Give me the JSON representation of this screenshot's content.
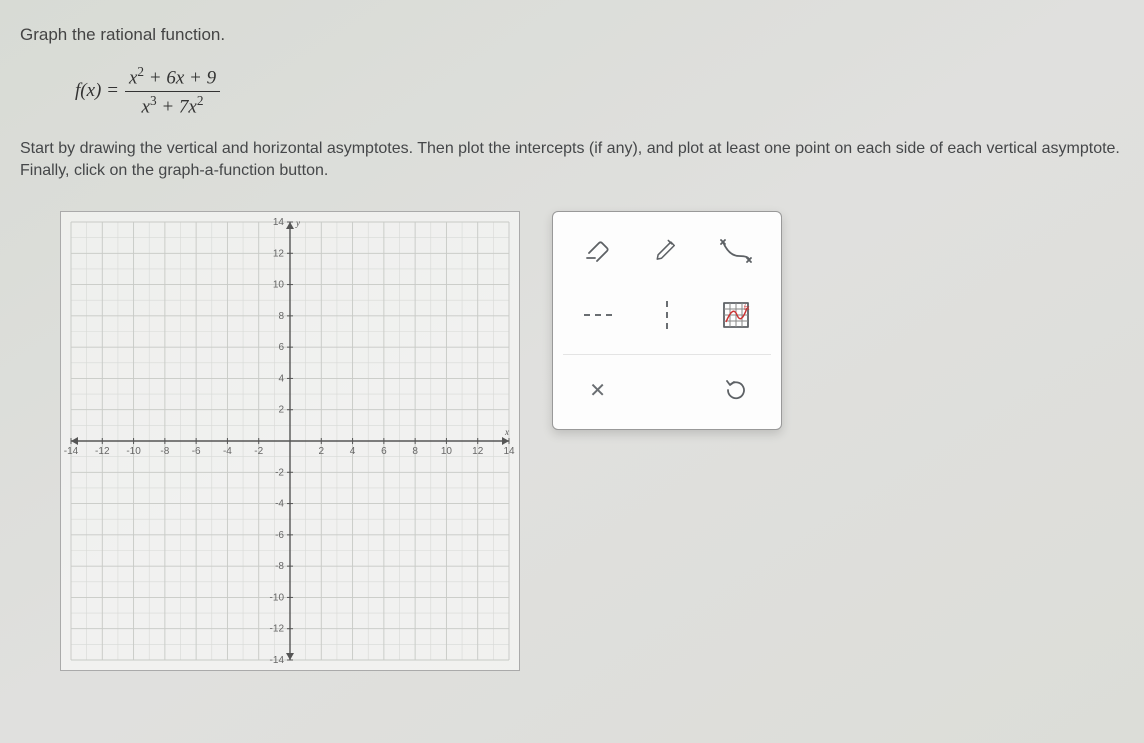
{
  "prompt": {
    "title": "Graph the rational function.",
    "instructions": "Start by drawing the vertical and horizontal asymptotes. Then plot the intercepts (if any), and plot at least one point on each side of each vertical asymptote. Finally, click on the graph-a-function button."
  },
  "equation": {
    "lhs": "f(x) =",
    "numerator_html": "x<span class='sup'>2</span> + 6x + 9",
    "denominator_html": "x<span class='sup'>3</span> + 7x<span class='sup'>2</span>"
  },
  "chart_data": {
    "type": "scatter",
    "title": "",
    "xlabel": "x",
    "ylabel": "y",
    "xlim": [
      -14,
      14
    ],
    "ylim": [
      -14,
      14
    ],
    "x_ticks": [
      -14,
      -12,
      -10,
      -8,
      -6,
      -4,
      -2,
      2,
      4,
      6,
      8,
      10,
      12,
      14
    ],
    "y_ticks": [
      -14,
      -12,
      -10,
      -8,
      -6,
      -4,
      -2,
      2,
      4,
      6,
      8,
      10,
      12,
      14
    ],
    "grid": true,
    "series": []
  },
  "toolbox": {
    "tools": {
      "eraser": "eraser-icon",
      "pencil": "pencil-icon",
      "curve": "curve-tool-icon",
      "h_asymptote": "horizontal-asymptote-icon",
      "v_asymptote": "vertical-asymptote-icon",
      "graph_function": "graph-a-function-icon",
      "clear": "clear-icon",
      "reset": "reset-icon"
    }
  }
}
